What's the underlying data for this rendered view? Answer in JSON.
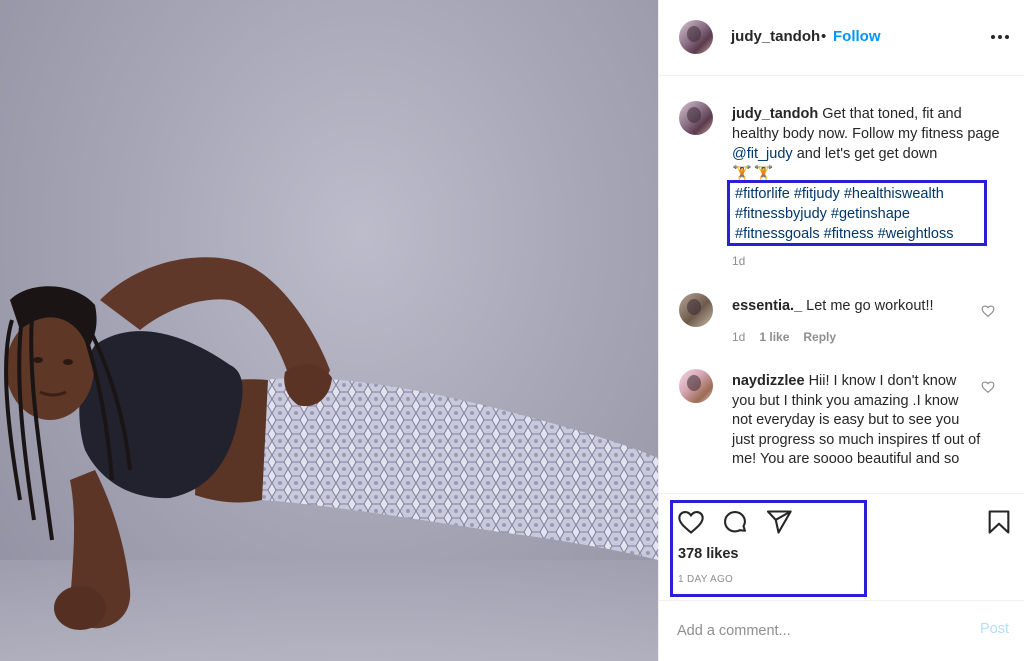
{
  "post": {
    "username": "judy_tandoh",
    "separator": "•",
    "follow_label": "Follow",
    "more_icon": "more-horizontal-icon"
  },
  "caption": {
    "username": "judy_tandoh",
    "text_before": "Get that toned, fit and healthy body now. Follow my fitness page",
    "mention": "@fit_judy",
    "text_after": "and let's get get down",
    "emoji": "🏋🏋",
    "hashtags": [
      "#fitforlife",
      "#fitjudy",
      "#healthiswealth",
      "#fitnessbyjudy",
      "#getinshape",
      "#fitnessgoals",
      "#fitness",
      "#weightloss"
    ],
    "time": "1d"
  },
  "comments": [
    {
      "username": "essentia._",
      "text": "Let me go workout!!",
      "time": "1d",
      "likes": "1 like",
      "reply_label": "Reply"
    },
    {
      "username": "naydizzlee",
      "text": "Hii! I know I don't know you but I think you amazing .I know not everyday is easy but to see you just progress so much inspires tf out of me! You are soooo beautiful and so"
    }
  ],
  "actions": {
    "icons": [
      "heart-icon",
      "comment-icon",
      "share-icon",
      "bookmark-icon"
    ],
    "likes": "378 likes",
    "time": "1 DAY AGO"
  },
  "add_comment": {
    "placeholder": "Add a comment...",
    "post_label": "Post"
  },
  "colors": {
    "accent_blue": "#0095f6",
    "hashtag_blue": "#00376b",
    "highlight_border": "#2a1fd6",
    "muted_text": "#8e8e8e",
    "post_disabled": "#b2dffc"
  }
}
